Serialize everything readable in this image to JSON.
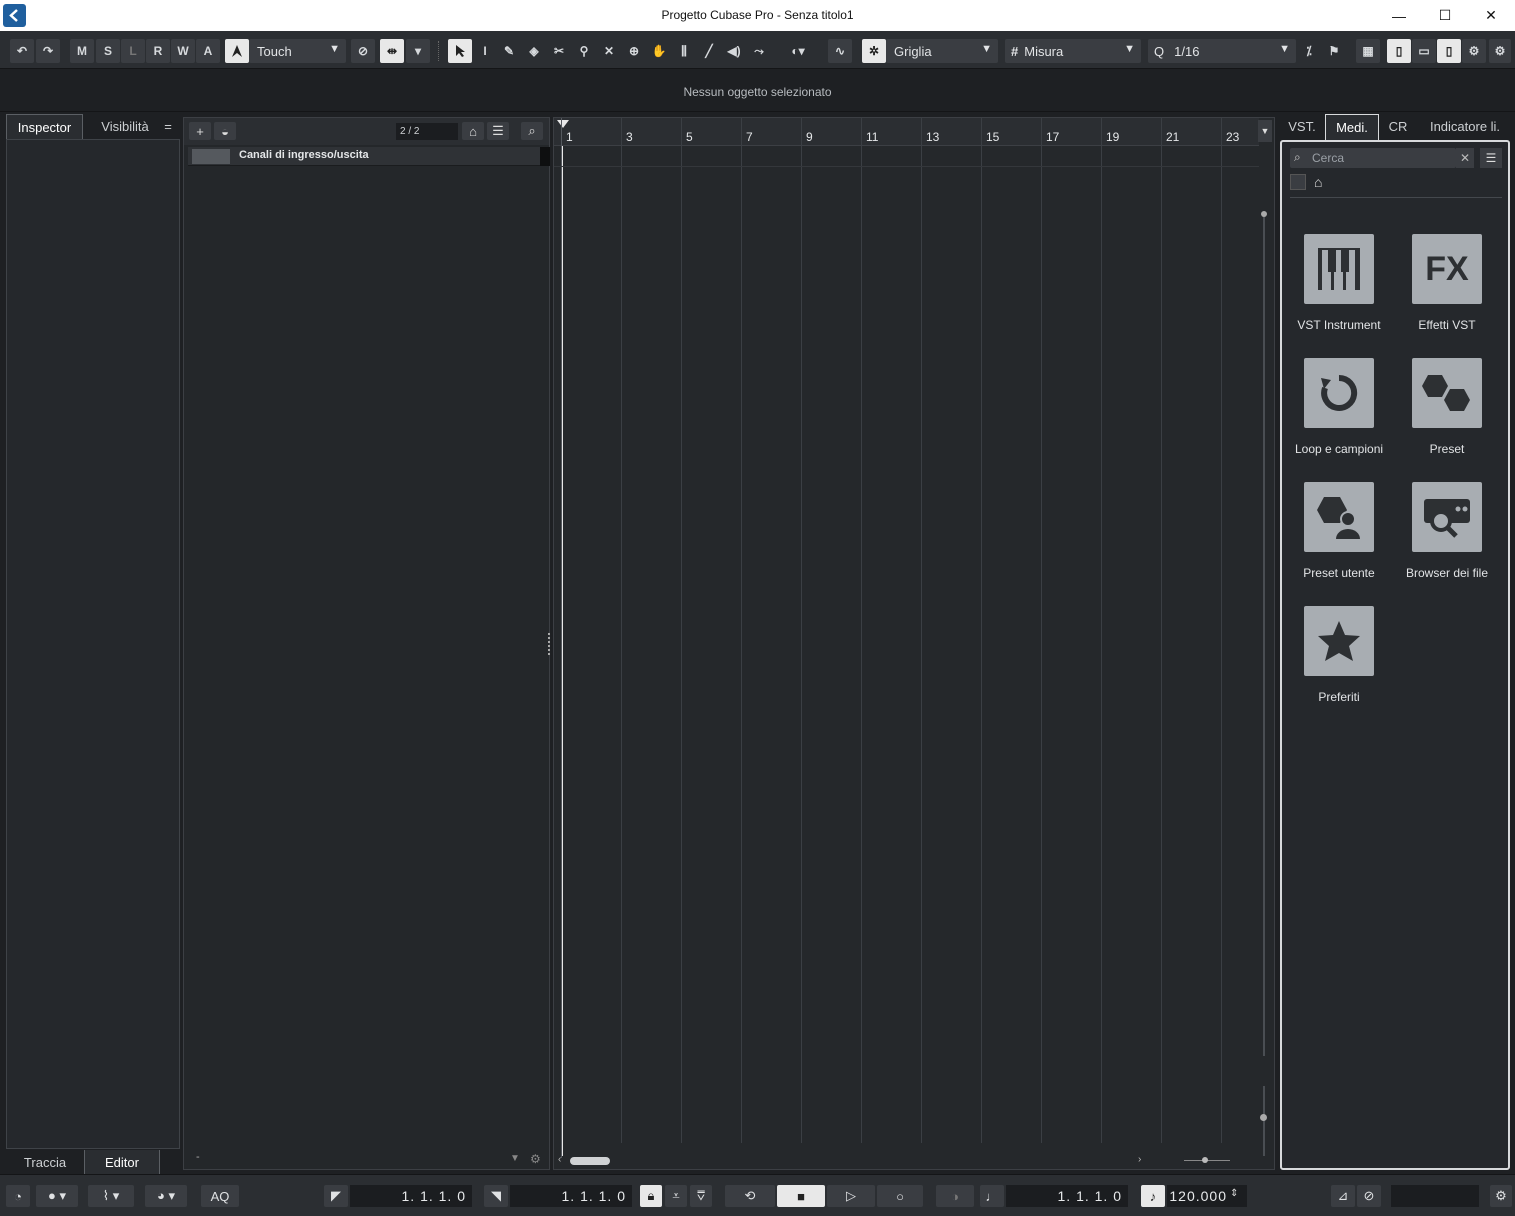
{
  "window": {
    "title": "Progetto Cubase Pro - Senza titolo1",
    "minimize": "—",
    "maximize": "☐",
    "close": "✕"
  },
  "toolbar": {
    "undo": "↶",
    "redo": "↷",
    "mute": "M",
    "solo": "S",
    "listen": "L",
    "read": "R",
    "write": "W",
    "auto": "A",
    "automation_mode": "Touch",
    "snap_type": "Griglia",
    "grid_type": "Misura",
    "quantize": "1/16"
  },
  "info_line": {
    "message": "Nessun oggetto selezionato"
  },
  "left_zone": {
    "tabs": [
      "Inspector",
      "Visibilità"
    ],
    "menu": "=",
    "bottom_tabs": [
      "Traccia",
      "Editor"
    ]
  },
  "track_list": {
    "count": "2 / 2",
    "tracks": [
      {
        "name": "Canali di ingresso/uscita"
      }
    ],
    "footer": "-"
  },
  "ruler": {
    "bars": [
      "1",
      "3",
      "5",
      "7",
      "9",
      "11",
      "13",
      "15",
      "17",
      "19",
      "21",
      "23"
    ]
  },
  "right_zone": {
    "tabs": [
      "VST.",
      "Medi.",
      "CR",
      "Indicatore li."
    ],
    "search_placeholder": "Cerca",
    "media_items": [
      {
        "label": "VST Instrument",
        "icon": "piano-keys-icon"
      },
      {
        "label": "Effetti VST",
        "icon": "fx-icon"
      },
      {
        "label": "Loop e campioni",
        "icon": "loop-icon"
      },
      {
        "label": "Preset",
        "icon": "hexagons-icon"
      },
      {
        "label": "Preset utente",
        "icon": "user-preset-icon"
      },
      {
        "label": "Browser dei file",
        "icon": "file-browser-icon"
      },
      {
        "label": "Preferiti",
        "icon": "star-icon"
      }
    ]
  },
  "transport": {
    "aq": "AQ",
    "left_locator": "1. 1. 1.   0",
    "right_locator": "1. 1. 1.   0",
    "position": "1. 1. 1.   0",
    "tempo": "120.000"
  },
  "colors": {
    "background": "#1e2023",
    "panel": "#25282c",
    "accent_tile": "#a8adb2"
  }
}
